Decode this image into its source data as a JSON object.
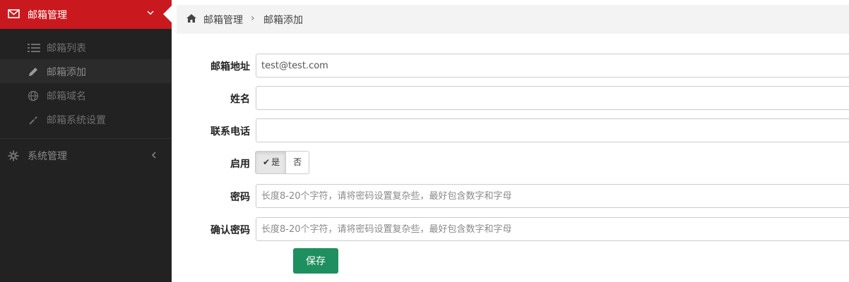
{
  "sidebar": {
    "header": {
      "icon": "mail-icon",
      "label": "邮箱管理"
    },
    "items": [
      {
        "icon": "list-icon",
        "label": "邮箱列表"
      },
      {
        "icon": "pencil-icon",
        "label": "邮箱添加",
        "active": true
      },
      {
        "icon": "globe-icon",
        "label": "邮箱域名"
      },
      {
        "icon": "wrench-icon",
        "label": "邮箱系统设置"
      }
    ],
    "system": {
      "icon": "gear-icon",
      "label": "系统管理"
    }
  },
  "breadcrumb": {
    "icon": "home-icon",
    "parent": "邮箱管理",
    "separator": "›",
    "current": "邮箱添加"
  },
  "form": {
    "email": {
      "label": "邮箱地址",
      "value": "test@test.com",
      "placeholder": ""
    },
    "name": {
      "label": "姓名",
      "value": ""
    },
    "phone": {
      "label": "联系电话",
      "value": ""
    },
    "enabled": {
      "label": "启用",
      "yes": "是",
      "no": "否",
      "selected": "是"
    },
    "password": {
      "label": "密码",
      "placeholder": "长度8-20个字符，请将密码设置复杂些，最好包含数字和字母"
    },
    "confirm": {
      "label": "确认密码",
      "placeholder": "长度8-20个字符，请将密码设置复杂些，最好包含数字和字母"
    },
    "save_label": "保存"
  },
  "colors": {
    "accent": "#c9191e",
    "sidebar_bg": "#222222",
    "save_button": "#1e8f5e"
  }
}
